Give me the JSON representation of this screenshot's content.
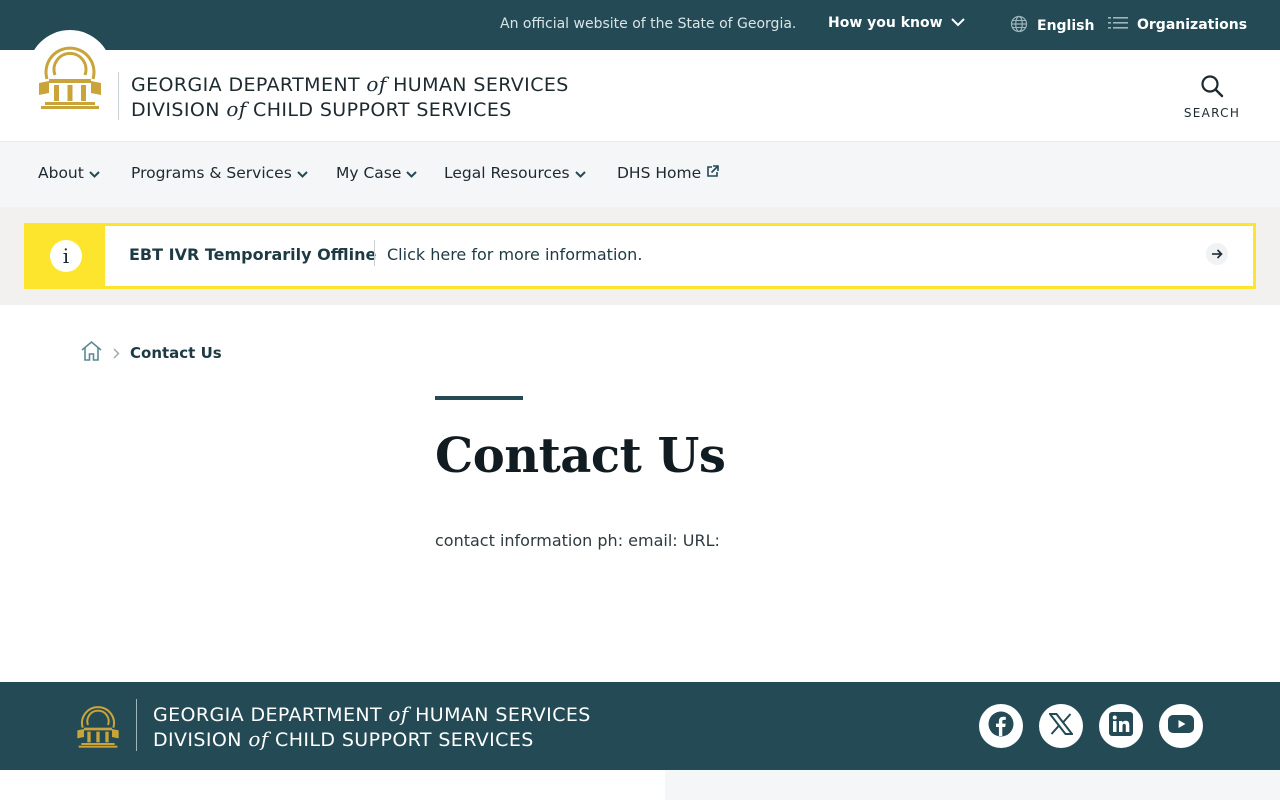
{
  "topbar": {
    "official_text": "An official website of the State of Georgia.",
    "how_you_know": "How you know",
    "language": "English",
    "organizations": "Organizations"
  },
  "header": {
    "brand_line1_a": "GEORGIA DEPARTMENT",
    "brand_of": "of",
    "brand_line1_b": "HUMAN SERVICES",
    "brand_line2_a": "DIVISION",
    "brand_line2_b": "CHILD SUPPORT SERVICES",
    "search_label": "SEARCH"
  },
  "nav": {
    "items": [
      {
        "label": "About"
      },
      {
        "label": "Programs & Services"
      },
      {
        "label": "My Case"
      },
      {
        "label": "Legal Resources"
      },
      {
        "label": "DHS Home"
      }
    ]
  },
  "alert": {
    "title": "EBT IVR Temporarily Offline",
    "message": "Click here for more information.",
    "icon": "i"
  },
  "breadcrumb": {
    "current": "Contact Us"
  },
  "main": {
    "title": "Contact Us",
    "content": "contact information ph: email: URL:"
  },
  "footer": {
    "brand_line1_a": "GEORGIA DEPARTMENT",
    "brand_of": "of",
    "brand_line1_b": "HUMAN SERVICES",
    "brand_line2_a": "DIVISION",
    "brand_line2_b": "CHILD SUPPORT SERVICES",
    "social": [
      "facebook-icon",
      "x-icon",
      "linkedin-icon",
      "youtube-icon"
    ]
  },
  "colors": {
    "primary": "#234a55",
    "alert_yellow": "#fde52d",
    "seal_gold": "#c9a43a"
  }
}
